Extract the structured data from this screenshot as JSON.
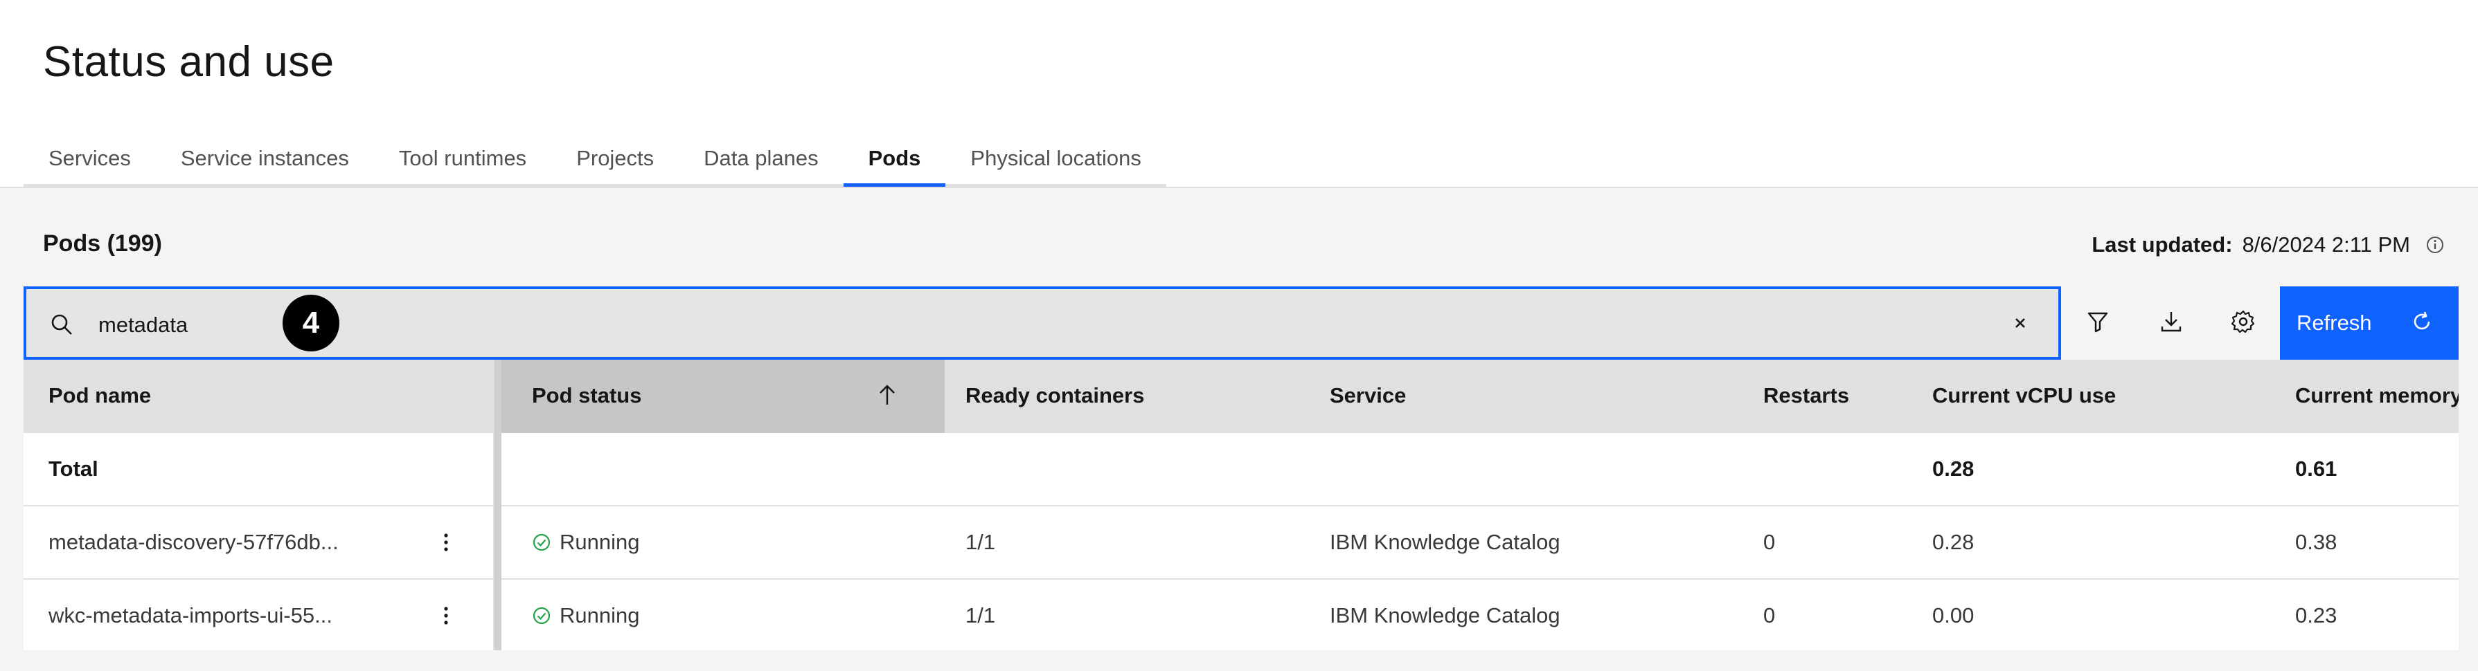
{
  "page": {
    "title": "Status and use"
  },
  "tabs": [
    {
      "label": "Services"
    },
    {
      "label": "Service instances"
    },
    {
      "label": "Tool runtimes"
    },
    {
      "label": "Projects"
    },
    {
      "label": "Data planes"
    },
    {
      "label": "Pods"
    },
    {
      "label": "Physical locations"
    }
  ],
  "active_tab": "Pods",
  "section": {
    "heading": "Pods (199)",
    "last_updated_label": "Last updated:",
    "last_updated_value": "8/6/2024 2:11 PM"
  },
  "search": {
    "value": "metadata",
    "step_badge": "4"
  },
  "toolbar": {
    "refresh_label": "Refresh"
  },
  "table": {
    "columns": [
      "Pod name",
      "Pod status",
      "Ready containers",
      "Service",
      "Restarts",
      "Current vCPU use",
      "Current memory"
    ],
    "sorted_column": "Pod status",
    "total": {
      "label": "Total",
      "vcpu": "0.28",
      "memory": "0.61"
    },
    "rows": [
      {
        "pod_name": "metadata-discovery-57f76db...",
        "status": "Running",
        "ready": "1/1",
        "service": "IBM Knowledge Catalog",
        "restarts": "0",
        "vcpu": "0.28",
        "memory": "0.38"
      },
      {
        "pod_name": "wkc-metadata-imports-ui-55...",
        "status": "Running",
        "ready": "1/1",
        "service": "IBM Knowledge Catalog",
        "restarts": "0",
        "vcpu": "0.00",
        "memory": "0.23"
      }
    ]
  },
  "colors": {
    "accent": "#0f62fe",
    "status_ok": "#24a148"
  },
  "icons": [
    "search-icon",
    "close-icon",
    "filter-icon",
    "download-icon",
    "settings-icon",
    "refresh-icon",
    "info-icon",
    "overflow-menu-icon",
    "checkmark-outline-icon",
    "arrow-up-icon"
  ]
}
